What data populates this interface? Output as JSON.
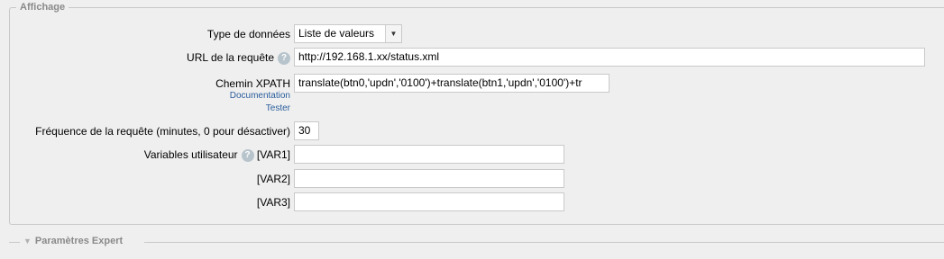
{
  "section": {
    "legend": "Affichage",
    "fields": {
      "data_type": {
        "label": "Type de données",
        "value": "Liste de valeurs"
      },
      "request_url": {
        "label": "URL de la requête",
        "value": "http://192.168.1.xx/status.xml"
      },
      "xpath": {
        "label": "Chemin XPATH",
        "value": "translate(btn0,'updn','0100')+translate(btn1,'updn','0100')+tr",
        "doc_link": "Documentation",
        "test_link": "Tester"
      },
      "frequency": {
        "label": "Fréquence de la requête (minutes, 0 pour désactiver)",
        "value": "30"
      },
      "user_vars": {
        "label": "Variables utilisateur",
        "var1_label": "[VAR1]",
        "var1_value": "",
        "var2_label": "[VAR2]",
        "var2_value": "",
        "var3_label": "[VAR3]",
        "var3_value": ""
      }
    }
  },
  "expert": {
    "title": "Paramètres Expert"
  },
  "icons": {
    "help": "?",
    "dropdown": "▼",
    "collapse": "▼"
  }
}
